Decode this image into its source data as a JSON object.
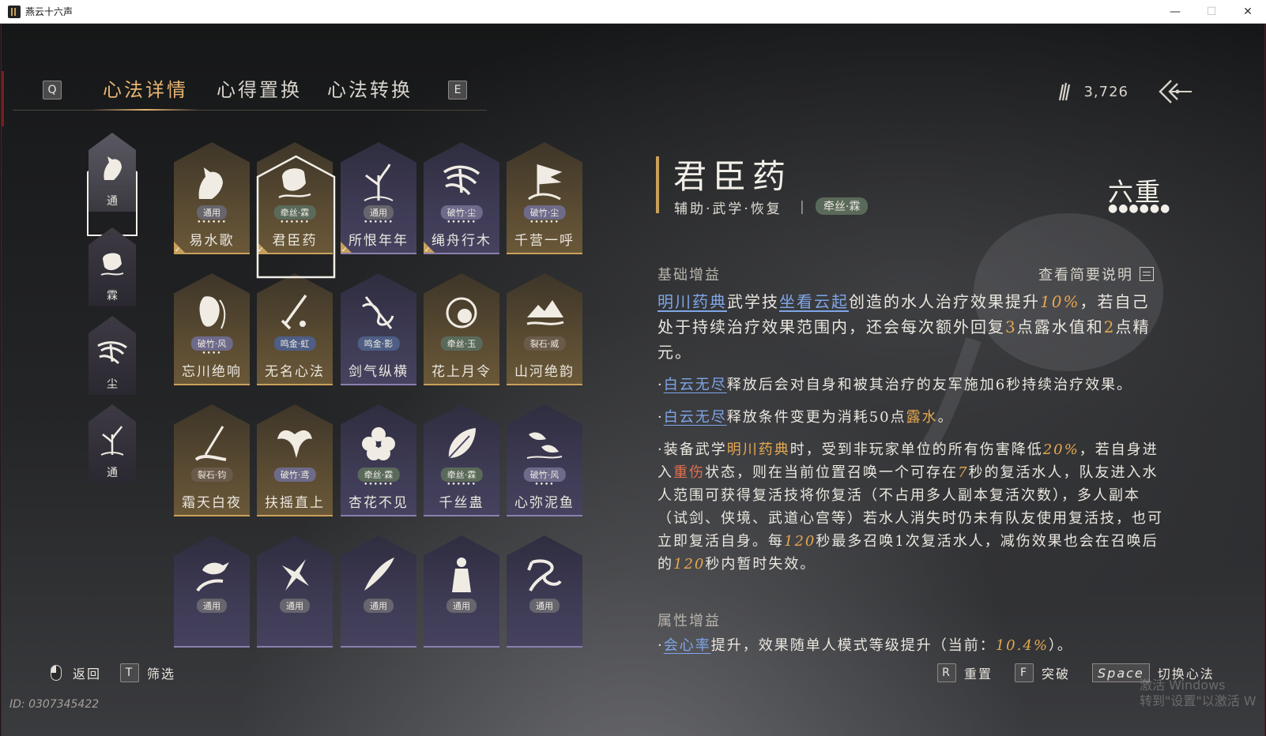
{
  "window": {
    "title": "燕云十六声",
    "minimize": "—",
    "maximize": "☐",
    "close": "✕"
  },
  "topnav": {
    "key_left": "Q",
    "key_right": "E",
    "tabs": [
      {
        "label": "心法详情",
        "active": true
      },
      {
        "label": "心得置换",
        "active": false
      },
      {
        "label": "心法转换",
        "active": false
      }
    ]
  },
  "currency": {
    "icon": "feather-coin-icon",
    "amount": "3,726"
  },
  "categories": [
    {
      "label": "通",
      "icon": "horse-icon",
      "active": true
    },
    {
      "label": "霖",
      "icon": "jar-icon",
      "active": false
    },
    {
      "label": "尘",
      "icon": "roots-icon",
      "active": false
    },
    {
      "label": "通",
      "icon": "plant-icon",
      "active": false
    }
  ],
  "cards": [
    {
      "name": "易水歌",
      "tag": "通用",
      "tag_style": "",
      "dots": "••••••",
      "icon": "horse-icon",
      "color": "gold",
      "equipped": true
    },
    {
      "name": "君臣药",
      "tag": "牵丝·霖",
      "tag_style": "tag-ys",
      "dots": "••••••",
      "icon": "jar-icon",
      "color": "gold",
      "equipped": true,
      "selected": true
    },
    {
      "name": "所恨年年",
      "tag": "通用",
      "tag_style": "",
      "dots": "••••••",
      "icon": "plant-icon",
      "color": "purple",
      "equipped": true
    },
    {
      "name": "绳舟行木",
      "tag": "破竹·尘",
      "tag_style": "tag-jz",
      "dots": "••••••",
      "icon": "roots-icon",
      "color": "purple",
      "equipped": true
    },
    {
      "name": "千营一呼",
      "tag": "破竹·尘",
      "tag_style": "tag-jz",
      "dots": "••••••",
      "icon": "flag-icon",
      "color": "gold",
      "equipped": false
    },
    {
      "name": "忘川绝响",
      "tag": "破竹·风",
      "tag_style": "tag-jz",
      "dots": "••••",
      "icon": "face-icon",
      "color": "gold",
      "equipped": false
    },
    {
      "name": "无名心法",
      "tag": "鸣金·虹",
      "tag_style": "tag-mj",
      "dots": "",
      "icon": "sword-icon",
      "color": "gold",
      "equipped": false
    },
    {
      "name": "剑气纵横",
      "tag": "鸣金·影",
      "tag_style": "tag-mj",
      "dots": "",
      "icon": "blade-icon",
      "color": "purple",
      "equipped": false
    },
    {
      "name": "花上月令",
      "tag": "牵丝·玉",
      "tag_style": "tag-ys",
      "dots": "",
      "icon": "flower-icon",
      "color": "gold",
      "equipped": false
    },
    {
      "name": "山河绝韵",
      "tag": "裂石·威",
      "tag_style": "tag-lt",
      "dots": "",
      "icon": "mountain-icon",
      "color": "gold",
      "equipped": false
    },
    {
      "name": "霜天白夜",
      "tag": "裂石·钧",
      "tag_style": "tag-lt",
      "dots": "",
      "icon": "brush-icon",
      "color": "gold",
      "equipped": false
    },
    {
      "name": "扶摇直上",
      "tag": "破竹·鸢",
      "tag_style": "tag-jz",
      "dots": "",
      "icon": "eagle-icon",
      "color": "gold",
      "equipped": false
    },
    {
      "name": "杏花不见",
      "tag": "牵丝·霖",
      "tag_style": "tag-ys",
      "dots": "••••••",
      "icon": "blossom-icon",
      "color": "purple",
      "equipped": false
    },
    {
      "name": "千丝蛊",
      "tag": "牵丝·霖",
      "tag_style": "tag-ys",
      "dots": "••••••",
      "icon": "leaf-icon",
      "color": "purple",
      "equipped": false
    },
    {
      "name": "心弥泥鱼",
      "tag": "破竹·风",
      "tag_style": "tag-jz",
      "dots": "••••",
      "icon": "fish-icon",
      "color": "purple",
      "equipped": false
    },
    {
      "name": "",
      "tag": "通用",
      "tag_style": "",
      "dots": "",
      "icon": "bird-hand-icon",
      "color": "purple",
      "equipped": false
    },
    {
      "name": "",
      "tag": "通用",
      "tag_style": "",
      "dots": "",
      "icon": "swallow-icon",
      "color": "purple",
      "equipped": false
    },
    {
      "name": "",
      "tag": "通用",
      "tag_style": "",
      "dots": "",
      "icon": "quill-icon",
      "color": "purple",
      "equipped": false
    },
    {
      "name": "",
      "tag": "通用",
      "tag_style": "",
      "dots": "",
      "icon": "figure-icon",
      "color": "purple",
      "equipped": false
    },
    {
      "name": "",
      "tag": "通用",
      "tag_style": "",
      "dots": "",
      "icon": "dragon-icon",
      "color": "purple",
      "equipped": false
    }
  ],
  "detail": {
    "title": "君臣药",
    "subtitle": "辅助·武学·恢复",
    "separator": "|",
    "tag": "牵丝·霖",
    "rank": "六重",
    "rank_dots": "●●●●●●",
    "base_heading": "基础增益",
    "view_desc": "查看简要说明",
    "attr_heading": "属性增益"
  },
  "hints": {
    "back": "返回",
    "filter_key": "T",
    "filter": "筛选",
    "reset_key": "R",
    "reset": "重置",
    "break_key": "F",
    "break": "突破",
    "switch_key": "Space",
    "switch": "切换心法"
  },
  "uid": "ID: 0307345422",
  "watermark": {
    "line1": "激活 Windows",
    "line2": "转到\"设置\"以激活 W"
  },
  "colors": {
    "accent": "#e8b572",
    "link": "#7fa6e8",
    "highlight": "#e7a84e",
    "danger": "#e0704e"
  }
}
